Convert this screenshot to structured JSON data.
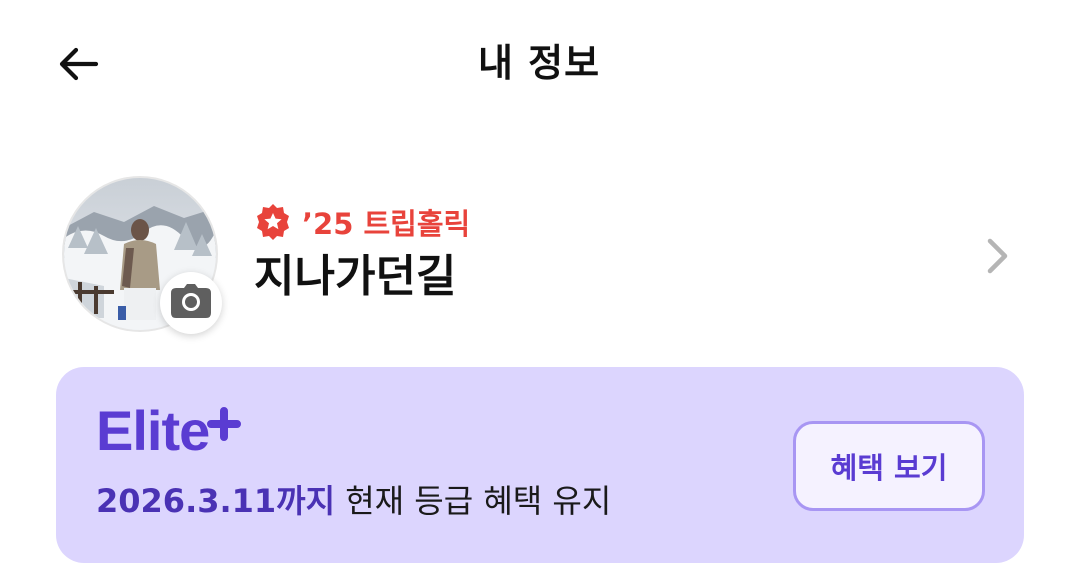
{
  "header": {
    "title": "내 정보",
    "back_icon": "arrow-left-icon"
  },
  "profile": {
    "badge_icon": "star-badge-icon",
    "badge_text": "’25 트립홀릭",
    "nickname": "지나가던길",
    "camera_icon": "camera-icon",
    "chevron_icon": "chevron-right-icon"
  },
  "membership": {
    "tier_name": "Elite",
    "tier_suffix": "+",
    "valid_until": "2026.3.11까지",
    "valid_desc": "현재 등급 혜택 유지",
    "benefit_button_label": "혜택 보기"
  },
  "colors": {
    "badge_red": "#e8433b",
    "elite_purple": "#5a3cd2",
    "card_background": "#dcd5fe",
    "button_border": "#a896f3"
  }
}
